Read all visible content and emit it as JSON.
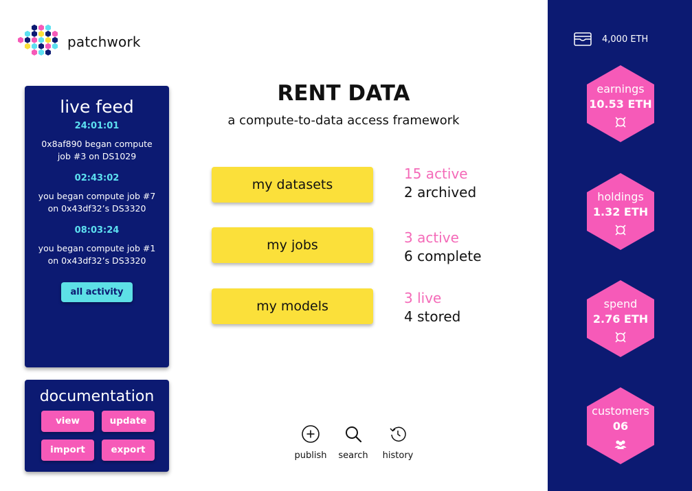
{
  "brand": {
    "name": "patchwork",
    "logo_icon": "hexagon-cluster-logo"
  },
  "live_feed": {
    "title": "live feed",
    "entries": [
      {
        "time": "24:01:01",
        "message": "0x8af890 began compute job #3 on DS1029"
      },
      {
        "time": "02:43:02",
        "message": "you began compute job #7 on 0x43df32’s DS3320"
      },
      {
        "time": "08:03:24",
        "message": "you began compute job #1 on 0x43df32’s DS3320"
      }
    ],
    "button_label": "all activity"
  },
  "documentation": {
    "title": "documentation",
    "buttons": {
      "view": "view",
      "update": "update",
      "import": "import",
      "export": "export"
    }
  },
  "main": {
    "title": "RENT DATA",
    "subtitle": "a compute-to-data access framework",
    "actions": [
      {
        "label": "my datasets",
        "primary_stat": "15 active",
        "secondary_stat": "2 archived"
      },
      {
        "label": "my jobs",
        "primary_stat": "3 active",
        "secondary_stat": "6 complete"
      },
      {
        "label": "my models",
        "primary_stat": "3 live",
        "secondary_stat": "4 stored"
      }
    ]
  },
  "toolbar": {
    "publish": {
      "label": "publish",
      "icon": "plus-circle-icon"
    },
    "search": {
      "label": "search",
      "icon": "search-icon"
    },
    "history": {
      "label": "history",
      "icon": "history-icon"
    }
  },
  "sidebar": {
    "wallet": {
      "balance": "4,000 ETH",
      "icon": "wallet-icon"
    },
    "metrics": [
      {
        "label": "earnings",
        "value": "10.53 ETH",
        "icon": "token-icon"
      },
      {
        "label": "holdings",
        "value": "1.32 ETH",
        "icon": "token-icon"
      },
      {
        "label": "spend",
        "value": "2.76 ETH",
        "icon": "token-icon"
      },
      {
        "label": "customers",
        "value": "06",
        "icon": "users-icon"
      }
    ]
  },
  "colors": {
    "navy": "#0c1a72",
    "pink": "#f65ab8",
    "yellow": "#fbe03a",
    "cyan": "#5de0f0",
    "stat_pink": "#f46ab8"
  }
}
